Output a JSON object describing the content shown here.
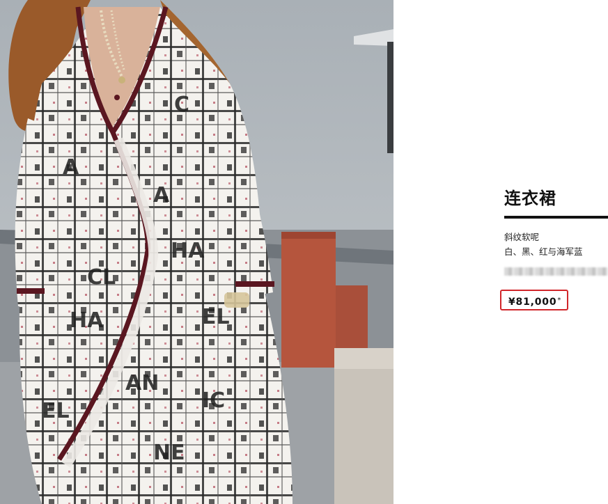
{
  "product": {
    "image_alt": "runway model wearing white tweed coat dress with black logo print",
    "title": "连衣裙",
    "material": "斜纹软呢",
    "colors": "白、黑、红与海军蓝",
    "price": "¥81,000",
    "price_note": "*"
  },
  "style": {
    "accent": "#d1262a",
    "text": "#111111",
    "background": "#ffffff"
  }
}
